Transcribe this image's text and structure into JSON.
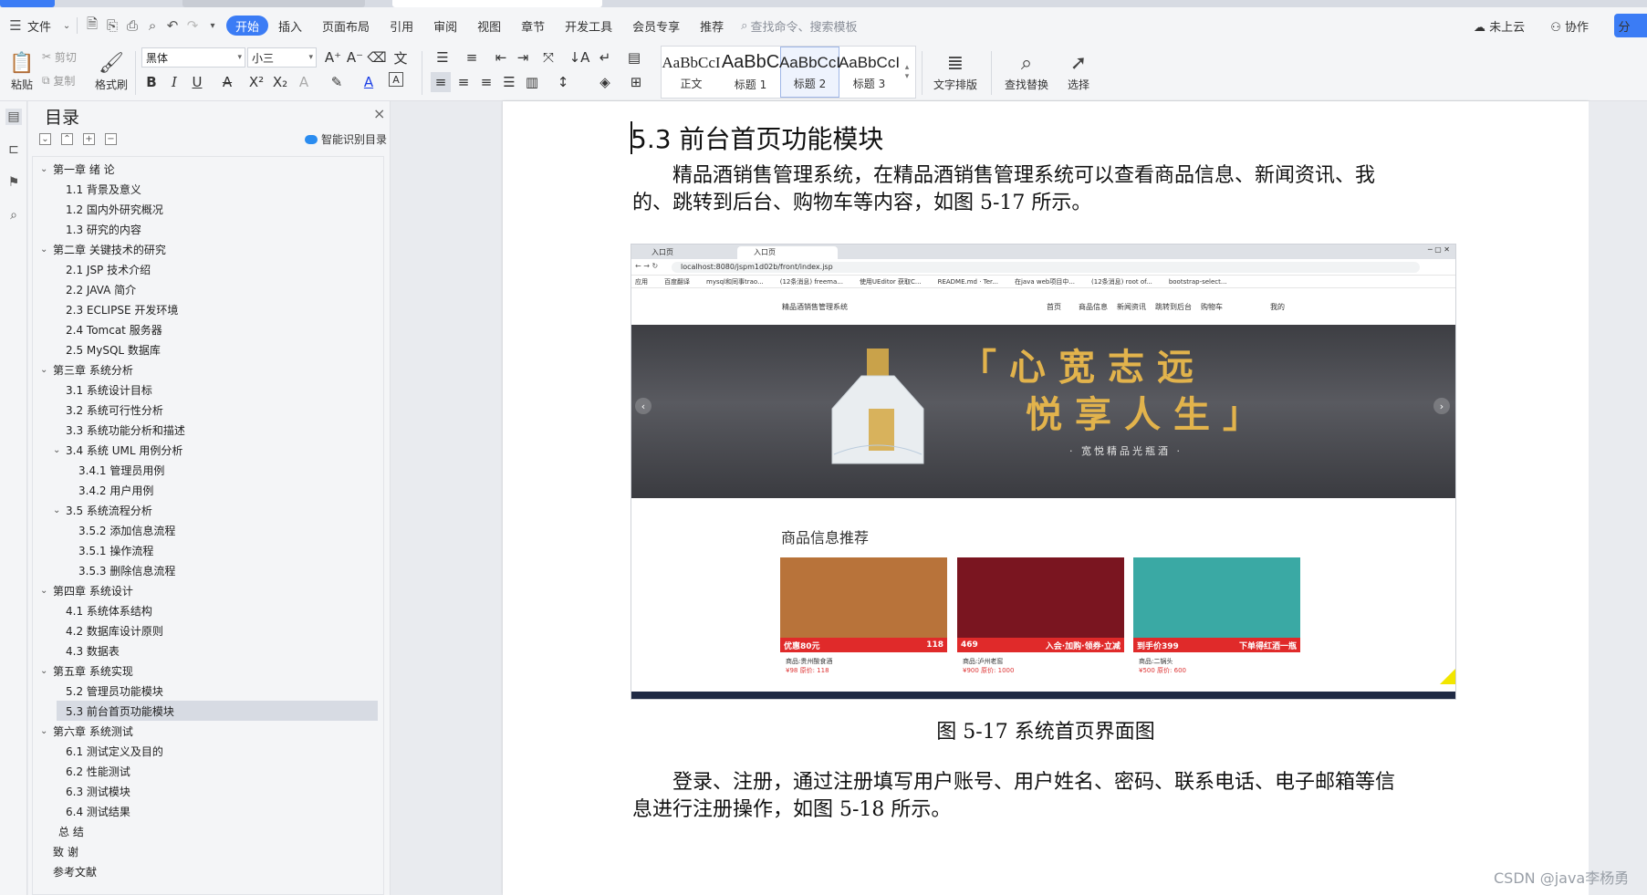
{
  "menu": {
    "file_label": "文件",
    "tabs": [
      "开始",
      "插入",
      "页面布局",
      "引用",
      "审阅",
      "视图",
      "章节",
      "开发工具",
      "会员专享",
      "推荐"
    ],
    "search_placeholder": "查找命令、搜索模板",
    "cloud_label": "未上云",
    "collab_label": "协作",
    "share_label": "分"
  },
  "ribbon": {
    "paste": "粘贴",
    "cut": "剪切",
    "copy": "复制",
    "format_painter": "格式刷",
    "font_name": "黑体",
    "font_size": "小三",
    "styles": [
      {
        "preview": "AaBbCcI",
        "name": "正文"
      },
      {
        "preview": "AaBbC",
        "name": "标题 1"
      },
      {
        "preview": "AaBbCcI",
        "name": "标题 2"
      },
      {
        "preview": "AaBbCcI",
        "name": "标题 3"
      }
    ],
    "text_layout": "文字排版",
    "find_replace": "查找替换",
    "select": "选择"
  },
  "toc": {
    "title": "目录",
    "smart_label": "智能识别目录",
    "items": [
      {
        "label": "第一章  绪  论",
        "level": 1,
        "caret": true
      },
      {
        "label": "1.1 背景及意义",
        "level": 2
      },
      {
        "label": "1.2 国内外研究概况",
        "level": 2
      },
      {
        "label": "1.3  研究的内容",
        "level": 2
      },
      {
        "label": "第二章  关键技术的研究",
        "level": 1,
        "caret": true
      },
      {
        "label": "2.1 JSP 技术介绍",
        "level": 2
      },
      {
        "label": "2.2 JAVA 简介",
        "level": 2
      },
      {
        "label": "2.3 ECLIPSE  开发环境",
        "level": 2
      },
      {
        "label": "2.4 Tomcat 服务器",
        "level": 2
      },
      {
        "label": "2.5 MySQL 数据库",
        "level": 2
      },
      {
        "label": "第三章  系统分析",
        "level": 1,
        "caret": true
      },
      {
        "label": "3.1  系统设计目标",
        "level": 2
      },
      {
        "label": "3.2  系统可行性分析",
        "level": 2
      },
      {
        "label": "3.3  系统功能分析和描述",
        "level": 2
      },
      {
        "label": "3.4 系统 UML 用例分析",
        "level": 2,
        "caret": true
      },
      {
        "label": "3.4.1 管理员用例",
        "level": 3
      },
      {
        "label": "3.4.2 用户用例",
        "level": 3
      },
      {
        "label": "3.5 系统流程分析",
        "level": 2,
        "caret": true
      },
      {
        "label": "3.5.2 添加信息流程",
        "level": 3
      },
      {
        "label": "3.5.1 操作流程",
        "level": 3
      },
      {
        "label": "3.5.3 删除信息流程",
        "level": 3
      },
      {
        "label": "第四章  系统设计",
        "level": 1,
        "caret": true
      },
      {
        "label": "4.1  系统体系结构",
        "level": 2
      },
      {
        "label": "4.2  数据库设计原则",
        "level": 2
      },
      {
        "label": "4.3  数据表",
        "level": 2
      },
      {
        "label": "第五章  系统实现",
        "level": 1,
        "caret": true
      },
      {
        "label": "5.2 管理员功能模块",
        "level": 2
      },
      {
        "label": "5.3 前台首页功能模块",
        "level": 2,
        "selected": true
      },
      {
        "label": "第六章   系统测试",
        "level": 1,
        "caret": true
      },
      {
        "label": "6.1 测试定义及目的",
        "level": 2
      },
      {
        "label": "6.2 性能测试",
        "level": 2
      },
      {
        "label": "6.3 测试模块",
        "level": 2
      },
      {
        "label": "6.4 测试结果",
        "level": 2
      },
      {
        "label": "总  结",
        "level": 1.5
      },
      {
        "label": "致  谢",
        "level": 1
      },
      {
        "label": "参考文献",
        "level": 1
      }
    ]
  },
  "doc": {
    "heading": "5.3 前台首页功能模块",
    "para1_line1": "　　精品酒销售管理系统，在精品酒销售管理系统可以查看商品信息、新闻资讯、我",
    "para1_line2": "的、跳转到后台、购物车等内容，如图 5-17 所示。",
    "caption": "图 5-17 系统首页界面图",
    "para2_line1": "　　登录、注册，通过注册填写用户账号、用户姓名、密码、联系电话、电子邮箱等信",
    "para2_line2": "息进行注册操作，如图 5-18 所示。"
  },
  "figure": {
    "tab1": "入口页",
    "tab2": "入口页",
    "url": "localhost:8080/jspm1d02b/front/index.jsp",
    "bookmarks": [
      "应用",
      "百度翻译",
      "mysql和同事trao...",
      "(12条消息) freema...",
      "使用UEditor 获取C...",
      "README.md · Ter...",
      "在java web项目中...",
      "(12条消息) root of...",
      "bootstrap-select..."
    ],
    "site_title": "精品酒销售管理系统",
    "nav": [
      "首页",
      "商品信息",
      "新闻资讯",
      "跳转到后台",
      "购物车",
      "我的"
    ],
    "slogan_line1": "「心宽志远",
    "slogan_line2": "悦享人生」",
    "banner_sub": "· 宽悦精品光瓶酒 ·",
    "rec_title": "商品信息推荐",
    "products": [
      {
        "promo": "优惠80元",
        "price_tag": "118",
        "name": "商品:贵州酸食酒",
        "price": "¥98 原价: 118",
        "color": "#b8733a"
      },
      {
        "promo": "469",
        "price_tag": "入会·加购·领券·立减",
        "name": "商品:泸州老窖",
        "price": "¥900 原价: 1000",
        "color": "#7a1520"
      },
      {
        "promo": "到手价399",
        "price_tag": "下单得红酒一瓶",
        "name": "商品:二锅头",
        "price": "¥500 原价: 600",
        "color": "#3aa9a4"
      }
    ]
  },
  "watermark": "CSDN @java李杨勇"
}
